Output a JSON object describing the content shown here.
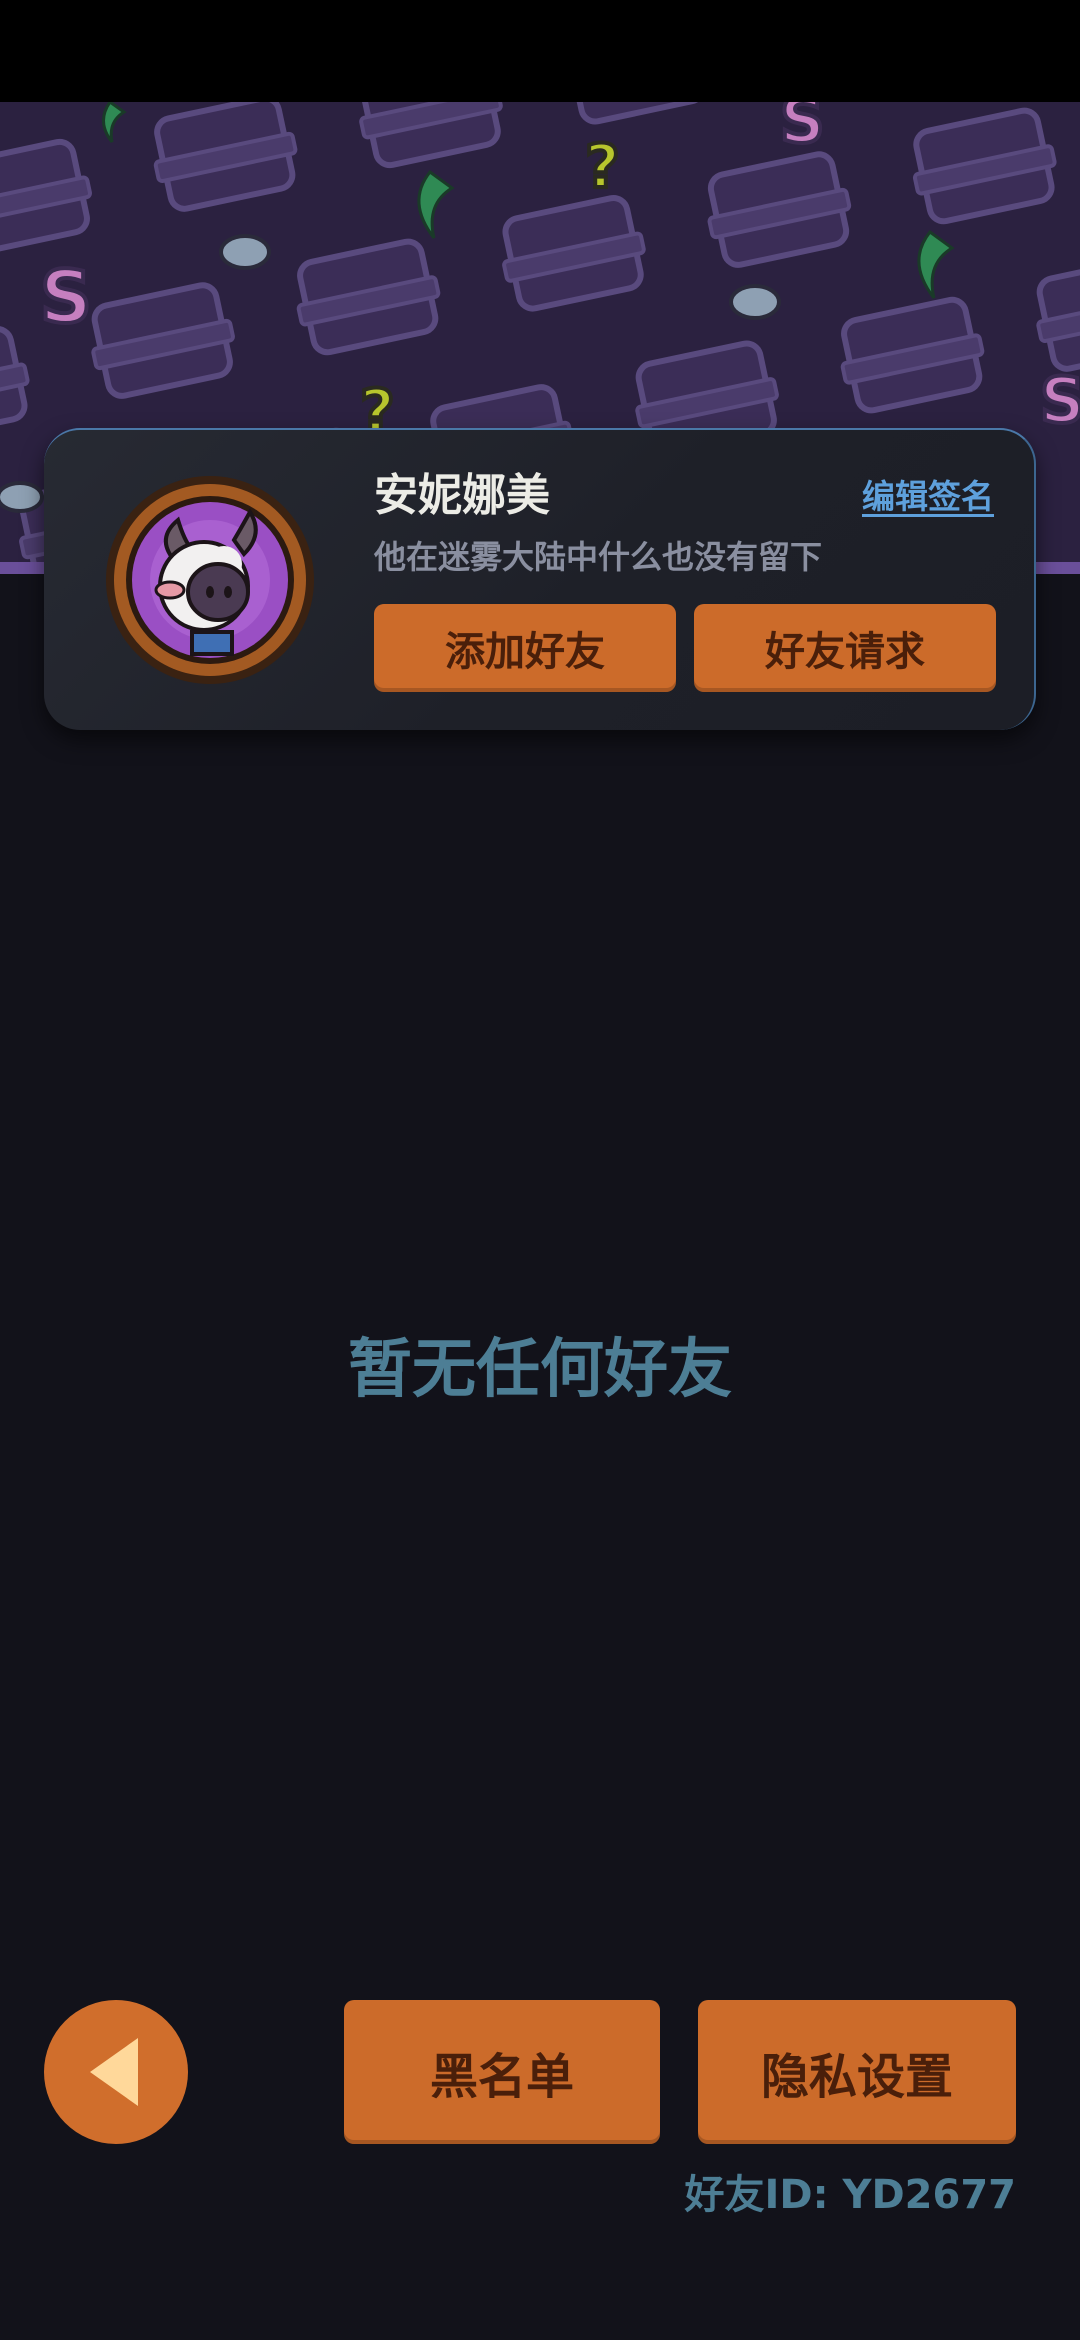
{
  "profile": {
    "username": "安妮娜美",
    "edit_signature_label": "编辑签名",
    "signature": "他在迷雾大陆中什么也没有留下",
    "add_friend_label": "添加好友",
    "friend_requests_label": "好友请求",
    "avatar_icon": "sheep-avatar-icon"
  },
  "main": {
    "empty_message": "暂无任何好友"
  },
  "footer": {
    "back_icon": "triangle-left-icon",
    "blacklist_label": "黑名单",
    "privacy_settings_label": "隐私设置",
    "friend_id_text": "好友ID: YD2677"
  },
  "colors": {
    "background": "#12121a",
    "accent_button": "#cc6b2a",
    "button_text": "#4a1f0a",
    "link": "#5ea0dc",
    "muted_text": "#4d7e95",
    "banner": "#2b2140"
  }
}
